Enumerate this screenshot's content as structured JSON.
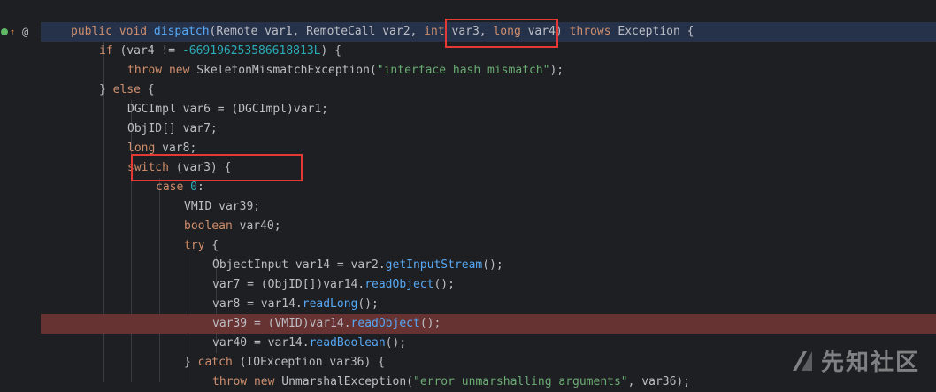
{
  "gutter": {
    "at_symbol": "@"
  },
  "code": {
    "lines": [
      [
        [
          "kw",
          "public void "
        ],
        [
          "fn",
          "dispatch"
        ],
        [
          "",
          "(Remote var1, RemoteCall var2, "
        ],
        [
          "kw",
          "int"
        ],
        [
          "",
          " var3, "
        ],
        [
          "kw",
          "long"
        ],
        [
          "",
          " var4) "
        ],
        [
          "kw",
          "throws"
        ],
        [
          "",
          " Exception {"
        ]
      ],
      [
        [
          "kw",
          "if"
        ],
        [
          "",
          " (var4 != "
        ],
        [
          "num",
          "-669196253586618813L"
        ],
        [
          "",
          ") {"
        ]
      ],
      [
        [
          "kw",
          "throw new"
        ],
        [
          "",
          " SkeletonMismatchException("
        ],
        [
          "str",
          "\"interface hash mismatch\""
        ],
        [
          "",
          ");"
        ]
      ],
      [
        [
          "",
          "} "
        ],
        [
          "kw",
          "else"
        ],
        [
          "",
          " {"
        ]
      ],
      [
        [
          "",
          "DGCImpl var6 = (DGCImpl)var1;"
        ]
      ],
      [
        [
          "",
          "ObjID[] var7;"
        ]
      ],
      [
        [
          "kw",
          "long"
        ],
        [
          "",
          " var8;"
        ]
      ],
      [
        [
          "kw",
          "switch"
        ],
        [
          "",
          " (var3) {"
        ]
      ],
      [
        [
          "kw",
          "case "
        ],
        [
          "num",
          "0"
        ],
        [
          "",
          ":"
        ]
      ],
      [
        [
          "",
          "VMID var39;"
        ]
      ],
      [
        [
          "kw",
          "boolean"
        ],
        [
          "",
          " var40;"
        ]
      ],
      [
        [
          "kw",
          "try"
        ],
        [
          "",
          " {"
        ]
      ],
      [
        [
          "",
          "ObjectInput var14 = var2."
        ],
        [
          "fn",
          "getInputStream"
        ],
        [
          "",
          "();"
        ]
      ],
      [
        [
          "",
          "var7 = (ObjID[])var14."
        ],
        [
          "fn",
          "readObject"
        ],
        [
          "",
          "();"
        ]
      ],
      [
        [
          "",
          "var8 = var14."
        ],
        [
          "fn",
          "readLong"
        ],
        [
          "",
          "();"
        ]
      ],
      [
        [
          "",
          "var39 = (VMID)var14."
        ],
        [
          "fn",
          "readObject"
        ],
        [
          "",
          "();"
        ]
      ],
      [
        [
          "",
          "var40 = var14."
        ],
        [
          "fn",
          "readBoolean"
        ],
        [
          "",
          "();"
        ]
      ],
      [
        [
          "",
          "} "
        ],
        [
          "kw",
          "catch"
        ],
        [
          "",
          " (IOException var36) {"
        ]
      ],
      [
        [
          "kw",
          "throw new"
        ],
        [
          "",
          " UnmarshalException("
        ],
        [
          "str",
          "\"error unmarshalling arguments\""
        ],
        [
          "",
          ", var36);"
        ]
      ]
    ]
  },
  "watermark": {
    "text": "先知社区"
  },
  "colors": {
    "keyword": "#cf8e6d",
    "function": "#56a8f5",
    "number": "#2aacb8",
    "string": "#6aab73",
    "breakpoint_line": "#673232",
    "current_line": "#26324a",
    "annotation_box": "#e53935"
  }
}
